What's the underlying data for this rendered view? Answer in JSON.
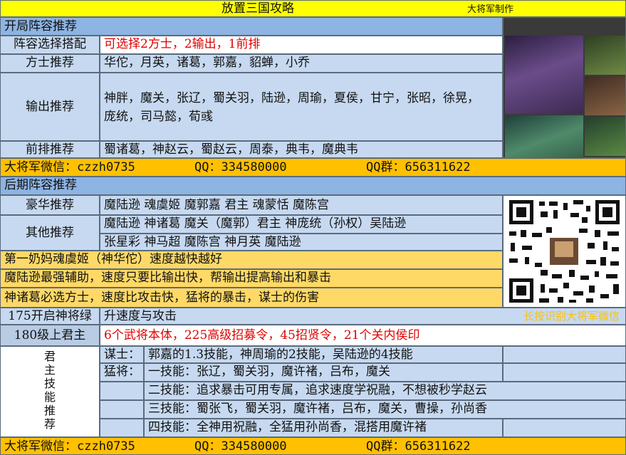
{
  "header": {
    "title": "放置三国攻略",
    "author": "大将军制作"
  },
  "section1": {
    "title": "开局阵容推荐",
    "rows": [
      {
        "label": "阵容选择搭配",
        "value": "可选择2方士，2输出，1前排"
      },
      {
        "label": "方士推荐",
        "value": "华佗，月英，诸葛，郭嘉，貂蝉，小乔"
      },
      {
        "label": "输出推荐",
        "value_line1": "神胖，魔关，张辽，蜀关羽，陆逊，周瑜，夏侯，甘宁，张昭，徐晃，",
        "value_line2": "庞统，司马懿，荀彧"
      },
      {
        "label": "前排推荐",
        "value": "蜀诸葛，神赵云，蜀赵云，周泰，典韦，魔典韦"
      }
    ]
  },
  "contact": {
    "wechat": "大将军微信：czzh0735",
    "qq": "QQ：334580000",
    "qq_group": "QQ群：656311622"
  },
  "section2": {
    "title": "后期阵容推荐",
    "rows": [
      {
        "label": "豪华推荐",
        "value": "魔陆逊 魂虞姬 魔郭嘉 君主 魂蒙恬 魔陈宫"
      },
      {
        "label": "其他推荐",
        "value_line1": "魔陆逊 神诸葛 魔关（魔郭）君主 神庞统（孙权）吴陆逊",
        "value_line2": "张星彩 神马超 魔陈宫 神月英 魔陆逊"
      }
    ],
    "notes": [
      "第一奶妈魂虞姬（神华佗）速度越快越好",
      "魔陆逊最强辅助，速度只要比输出快，帮输出提高输出和暴击",
      "神诸葛必选方士，速度比攻击快，猛将的暴击，谋士的伤害"
    ]
  },
  "level175": {
    "label": "175开启神将绿",
    "value": "升速度与攻击",
    "qr_hint": "长按识别大将军微信"
  },
  "level180": {
    "label": "180级上君主",
    "value": "6个武将本体，225高级招募令，45招贤令，21个关内侯印"
  },
  "lord_skills": {
    "label_chars": [
      "君",
      "主",
      "技",
      "能",
      "推",
      "荐"
    ],
    "strategist_label": "谋士：",
    "strategist_value": "郭嘉的1.3技能，神周瑜的2技能，吴陆逊的4技能",
    "warrior_label": "猛将：",
    "warrior_rows": [
      "一技能：张辽，蜀关羽，魔许褚，吕布，魔关",
      "二技能：追求暴击可用专属，追求速度学祝融，不想被秒学赵云",
      "三技能：蜀张飞，蜀关羽，魔许褚，吕布，魔关，曹操，孙尚香",
      "四技能：全神用祝融，全猛用孙尚香，混搭用魔许褚"
    ]
  },
  "colors": {
    "title_bar": "#ffff00",
    "section_header": "#8db4e2",
    "cell_blue": "#c6d9f0",
    "contact_bar": "#ffc000",
    "note_bar": "#ffd966",
    "highlight_red": "#e00000"
  }
}
